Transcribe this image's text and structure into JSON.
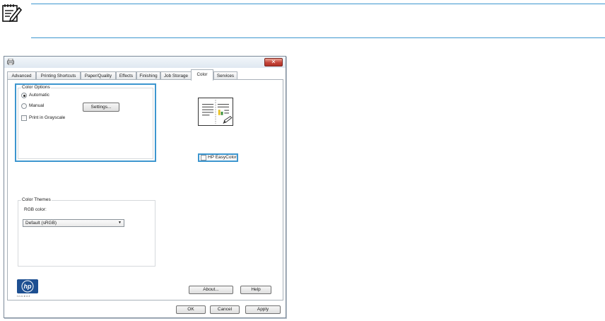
{
  "dialog": {
    "tabs": [
      "Advanced",
      "Printing Shortcuts",
      "Paper/Quality",
      "Effects",
      "Finishing",
      "Job Storage",
      "Color",
      "Services"
    ],
    "active_tab": "Color",
    "close_label": "✕"
  },
  "color_options": {
    "legend": "Color Options",
    "automatic_label": "Automatic",
    "manual_label": "Manual",
    "settings_button": "Settings...",
    "grayscale_label": "Print in Grayscale",
    "selected": "Automatic",
    "grayscale_checked": false
  },
  "easycolor": {
    "label": "HP EasyColor",
    "checked": false
  },
  "color_themes": {
    "legend": "Color Themes",
    "rgb_label": "RGB color:",
    "rgb_value": "Default (sRGB)"
  },
  "footer": {
    "about_button": "About...",
    "help_button": "Help",
    "ok_button": "OK",
    "cancel_button": "Cancel",
    "apply_button": "Apply"
  },
  "brand": {
    "logo_text": "hp",
    "logo_sub": "invent"
  },
  "colors": {
    "accent": "#3d96cf",
    "hp_blue": "#1d4f91",
    "close_red": "#c5443a"
  },
  "icons": [
    "note-icon",
    "printer-icon",
    "close-icon",
    "color-preview-icon",
    "dropdown-arrow-icon",
    "hp-logo-icon"
  ]
}
